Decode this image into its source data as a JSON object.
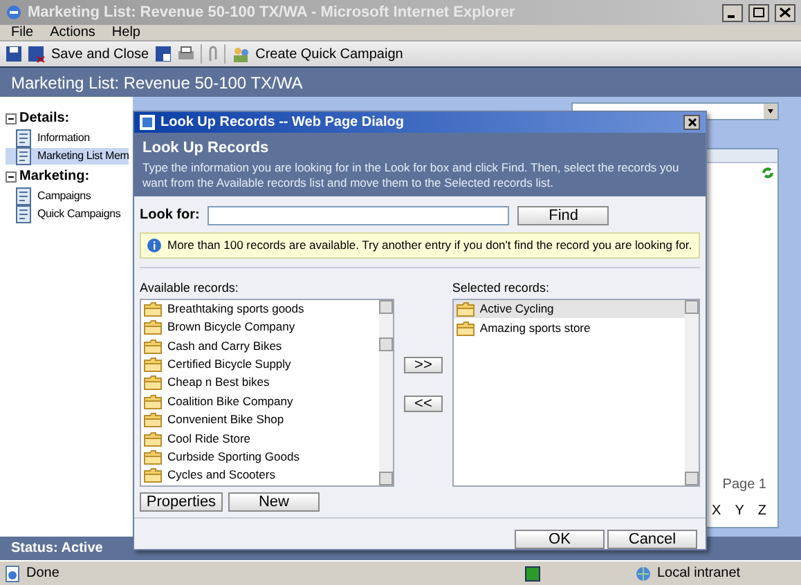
{
  "window": {
    "title": "Marketing List: Revenue 50-100 TX/WA - Microsoft Internet Explorer"
  },
  "menu": [
    "File",
    "Actions",
    "Help"
  ],
  "toolbar": {
    "save_and_close": "Save and Close",
    "create_quick_campaign": "Create Quick Campaign"
  },
  "header": {
    "title": "Marketing List: Revenue 50-100 TX/WA"
  },
  "nav": [
    {
      "title": "Details:",
      "expanded": true,
      "items": [
        {
          "label": "Information",
          "selected": false
        },
        {
          "label": "Marketing List Mem",
          "selected": true
        }
      ]
    },
    {
      "title": "Marketing:",
      "expanded": true,
      "items": [
        {
          "label": "Campaigns",
          "selected": false
        },
        {
          "label": "Quick Campaigns",
          "selected": false
        }
      ]
    }
  ],
  "background": {
    "pager": "Page 1",
    "letters": [
      "X",
      "Y",
      "Z"
    ]
  },
  "dialog": {
    "title": "Look Up Records -- Web Page Dialog",
    "heading": "Look Up Records",
    "description": "Type the information you are looking for in the Look for box and click Find. Then, select the records you want from the Available records list and move them to the Selected records list.",
    "look_for_label": "Look for:",
    "find": "Find",
    "info": "More than 100 records are available. Try another entry if you don't find the record you are looking for.",
    "available_label": "Available records:",
    "available": [
      "Breathtaking sports goods",
      "Brown Bicycle Company",
      "Cash and Carry Bikes",
      "Certified Bicycle Supply",
      "Cheap n Best bikes",
      "Coalition Bike Company",
      "Convenient Bike Shop",
      "Cool Ride Store",
      "Curbside Sporting Goods",
      "Cycles and Scooters"
    ],
    "add": ">>",
    "remove": "<<",
    "selected_label": "Selected records:",
    "selected": [
      {
        "label": "Active Cycling",
        "selected": true
      },
      {
        "label": "Amazing sports store",
        "selected": false
      }
    ],
    "properties": "Properties",
    "new": "New",
    "ok": "OK",
    "cancel": "Cancel"
  },
  "status": "Status: Active",
  "ie_status": {
    "text": "Done",
    "zone": "Local intranet"
  }
}
